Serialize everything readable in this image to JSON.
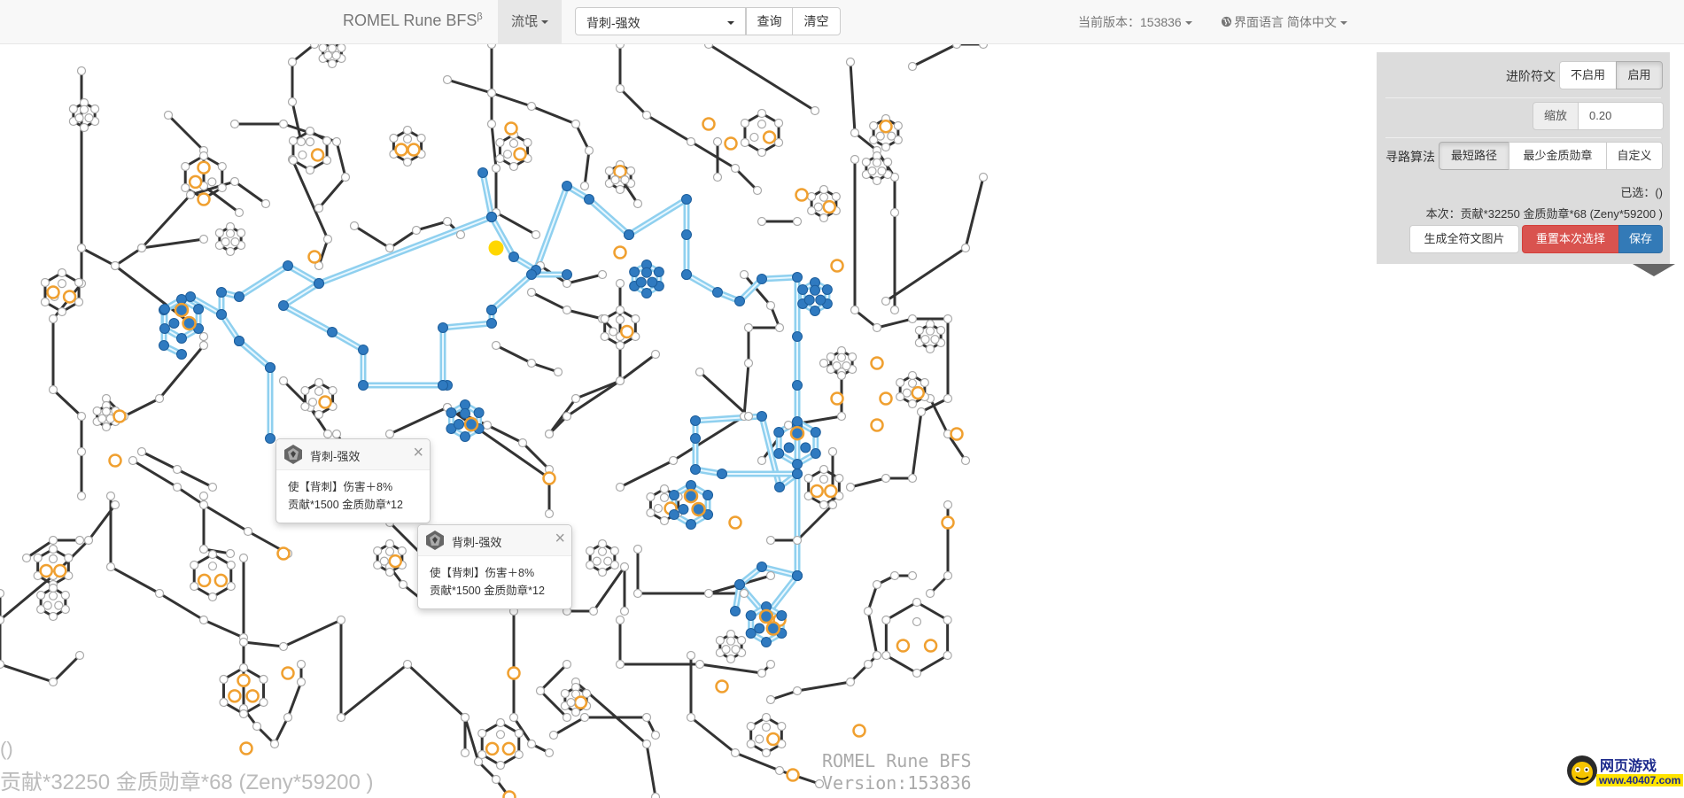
{
  "navbar": {
    "brand": "ROMEL Rune BFS",
    "brand_sup": "β",
    "dropdown": "流氓",
    "rune_select": "背刺-强效",
    "query_button": "查询",
    "clear_button": "清空",
    "version": "当前版本：153836",
    "language": "界面语言 简体中文"
  },
  "panel": {
    "advanced_label": "进阶符文",
    "advanced_options": [
      "不启用",
      "启用"
    ],
    "advanced_selected": "启用",
    "zoom_label": "缩放",
    "zoom_value": "0.20",
    "algo_label": "寻路算法",
    "algo_options": [
      "最短路径",
      "最少金质勋章",
      "自定义"
    ],
    "algo_selected": "最短路径",
    "selected_text": "已选：()",
    "cost_text": "本次：贡献*32250 金质勋章*68 (Zeny*59200 )",
    "generate_button": "生成全符文图片",
    "reset_button": "重置本次选择",
    "save_button": "保存"
  },
  "popovers": [
    {
      "title": "背刺-强效",
      "line1": "使【背刺】伤害＋8%",
      "line2": "贡献*1500 金质勋章*12"
    },
    {
      "title": "背刺-强效",
      "line1": "使【背刺】伤害＋8%",
      "line2": "贡献*1500 金质勋章*12"
    }
  ],
  "watermark": {
    "paren": "()",
    "cost": "贡献*32250 金质勋章*68 (Zeny*59200 )",
    "app_line1": "ROMEL Rune BFS",
    "app_line2": "Version:153836"
  },
  "logo": {
    "line1": "网页游戏",
    "line2": "www.40407.com"
  },
  "colors": {
    "edge": "#333333",
    "node": "#ffffff",
    "node_stroke": "#aaaaaa",
    "special_node": "#f0a030",
    "selected": "#2f7ac0",
    "selected_path": "#8fd0ef",
    "start_node": "#ffd700",
    "danger": "#d9534f",
    "primary": "#337ab7"
  },
  "icons": [
    "caret-down-icon",
    "globe-icon",
    "close-icon",
    "rune-icon"
  ]
}
